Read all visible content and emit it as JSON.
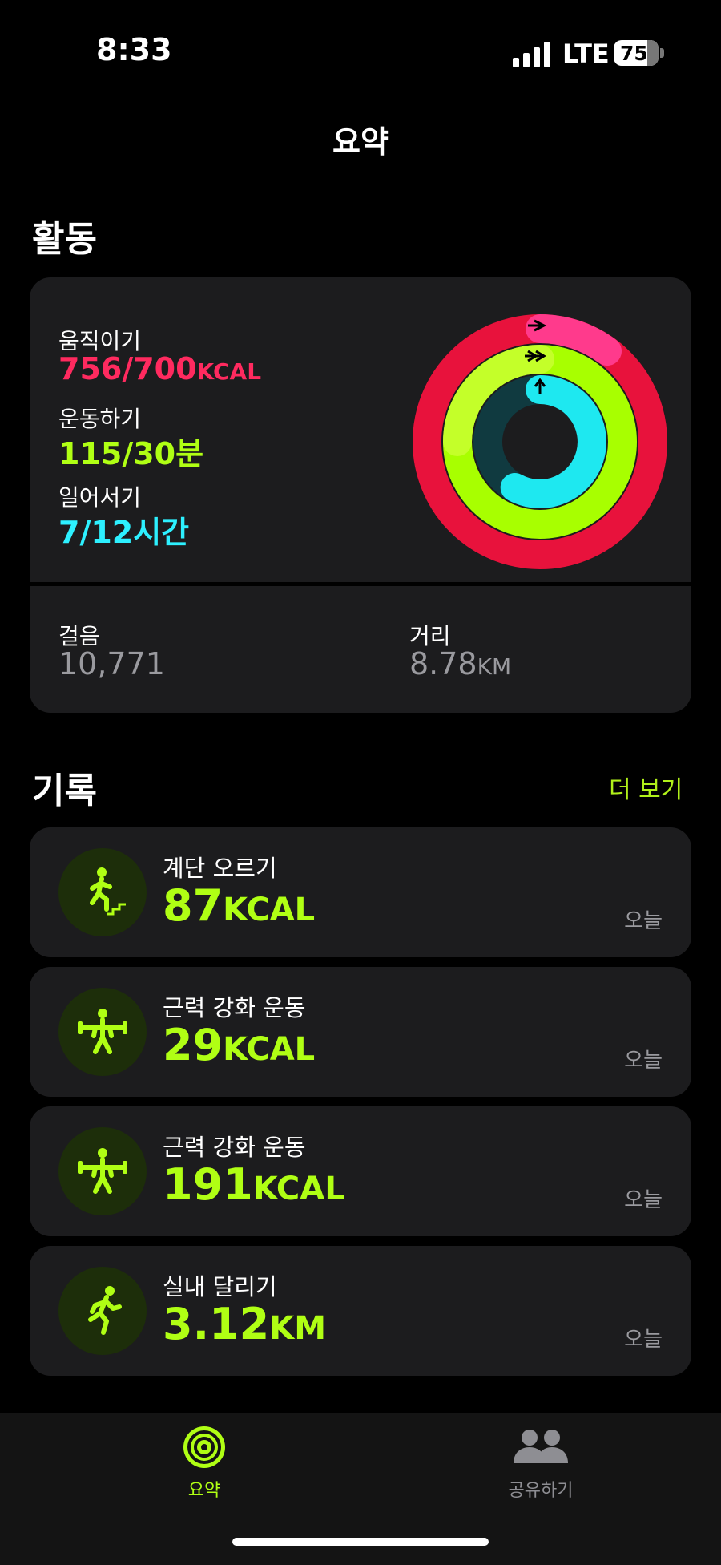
{
  "status": {
    "time": "8:33",
    "network": "LTE",
    "battery": "75"
  },
  "nav": {
    "title": "요약"
  },
  "activity": {
    "title": "활동",
    "move": {
      "label": "움직이기",
      "value": "756/700",
      "unit": "KCAL",
      "progress": 1.08
    },
    "exercise": {
      "label": "운동하기",
      "value": "115/30",
      "unit": "분",
      "progress": 3.83
    },
    "stand": {
      "label": "일어서기",
      "value": "7/12",
      "unit": "시간",
      "progress": 0.58
    },
    "steps": {
      "label": "걸음",
      "value": "10,771"
    },
    "distance": {
      "label": "거리",
      "value": "8.78",
      "unit": "KM"
    }
  },
  "history": {
    "title": "기록",
    "more": "더 보기",
    "items": [
      {
        "name": "계단 오르기",
        "value": "87",
        "unit": "KCAL",
        "date": "오늘",
        "icon": "stair-climbing-icon"
      },
      {
        "name": "근력 강화 운동",
        "value": "29",
        "unit": "KCAL",
        "date": "오늘",
        "icon": "strength-training-icon"
      },
      {
        "name": "근력 강화 운동",
        "value": "191",
        "unit": "KCAL",
        "date": "오늘",
        "icon": "strength-training-icon"
      },
      {
        "name": "실내 달리기",
        "value": "3.12",
        "unit": "KM",
        "date": "오늘",
        "icon": "running-icon"
      }
    ]
  },
  "tabs": {
    "summary": "요약",
    "sharing": "공유하기"
  },
  "colors": {
    "move": "#ff2a5f",
    "exercise": "#b0ff14",
    "stand": "#2df0ff",
    "card": "#1c1c1e"
  }
}
